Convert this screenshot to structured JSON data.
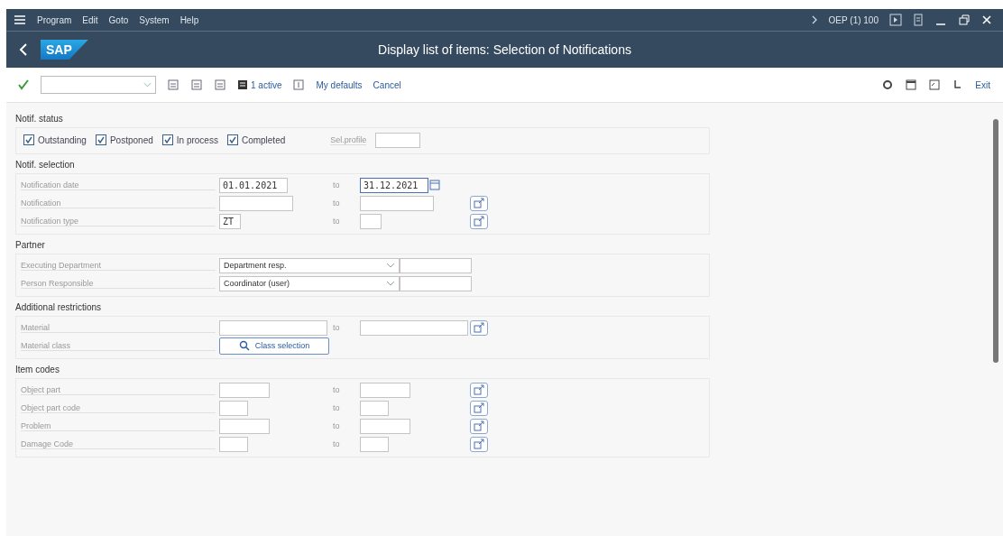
{
  "menu": [
    "Program",
    "Edit",
    "Goto",
    "System",
    "Help"
  ],
  "system": "OEP (1) 100",
  "logo": "SAP",
  "title": "Display list of items: Selection of Notifications",
  "toolbar": {
    "active_label": "1 active",
    "links": [
      "My defaults",
      "Cancel"
    ],
    "exit": "Exit"
  },
  "sections": [
    {
      "title": "Notif. status",
      "kind": "checkboxes",
      "items": [
        {
          "label": "Outstanding",
          "checked": true
        },
        {
          "label": "Postponed",
          "checked": true
        },
        {
          "label": "In process",
          "checked": true
        },
        {
          "label": "Completed",
          "checked": true
        }
      ],
      "profile": {
        "label": "Sel.profile"
      }
    },
    {
      "title": "Notif. selection",
      "kind": "rows",
      "rows": [
        {
          "kind": "range",
          "label": "Notification date",
          "from": "01.01.2021",
          "to_label": "to",
          "to": "31.12.2021",
          "focused": true,
          "multi": false
        },
        {
          "kind": "range",
          "label": "Notification",
          "from": "",
          "to_label": "to",
          "to": "",
          "focused": false,
          "multi": true
        },
        {
          "kind": "range",
          "label": "Notification type",
          "from": "ZT",
          "to_label": "to",
          "to": "",
          "focused": false,
          "multi": true
        }
      ]
    },
    {
      "title": "Partner",
      "kind": "rows",
      "rows": [
        {
          "kind": "dropdown",
          "label": "Executing Department",
          "value": "Department resp."
        },
        {
          "kind": "dropdown",
          "label": "Person Responsible",
          "value": "Coordinator (user)"
        }
      ]
    },
    {
      "title": "Additional restrictions",
      "kind": "rows",
      "rows": [
        {
          "kind": "range",
          "label": "Material",
          "from": "",
          "to_label": "to",
          "to": "",
          "focused": false,
          "multi": true
        },
        {
          "kind": "button",
          "label": "Material class",
          "button": "Class selection"
        }
      ]
    },
    {
      "title": "Item codes",
      "kind": "rows",
      "rows": [
        {
          "kind": "range",
          "label": "Object part",
          "from": "",
          "to_label": "to",
          "to": "",
          "focused": false,
          "multi": true
        },
        {
          "kind": "range",
          "label": "Object part code",
          "from": "",
          "to_label": "to",
          "to": "",
          "focused": false,
          "multi": true
        },
        {
          "kind": "range",
          "label": "Problem",
          "from": "",
          "to_label": "to",
          "to": "",
          "focused": false,
          "multi": true
        },
        {
          "kind": "range",
          "label": "Damage Code",
          "from": "",
          "to_label": "to",
          "to": "",
          "focused": false,
          "multi": true
        }
      ]
    }
  ]
}
